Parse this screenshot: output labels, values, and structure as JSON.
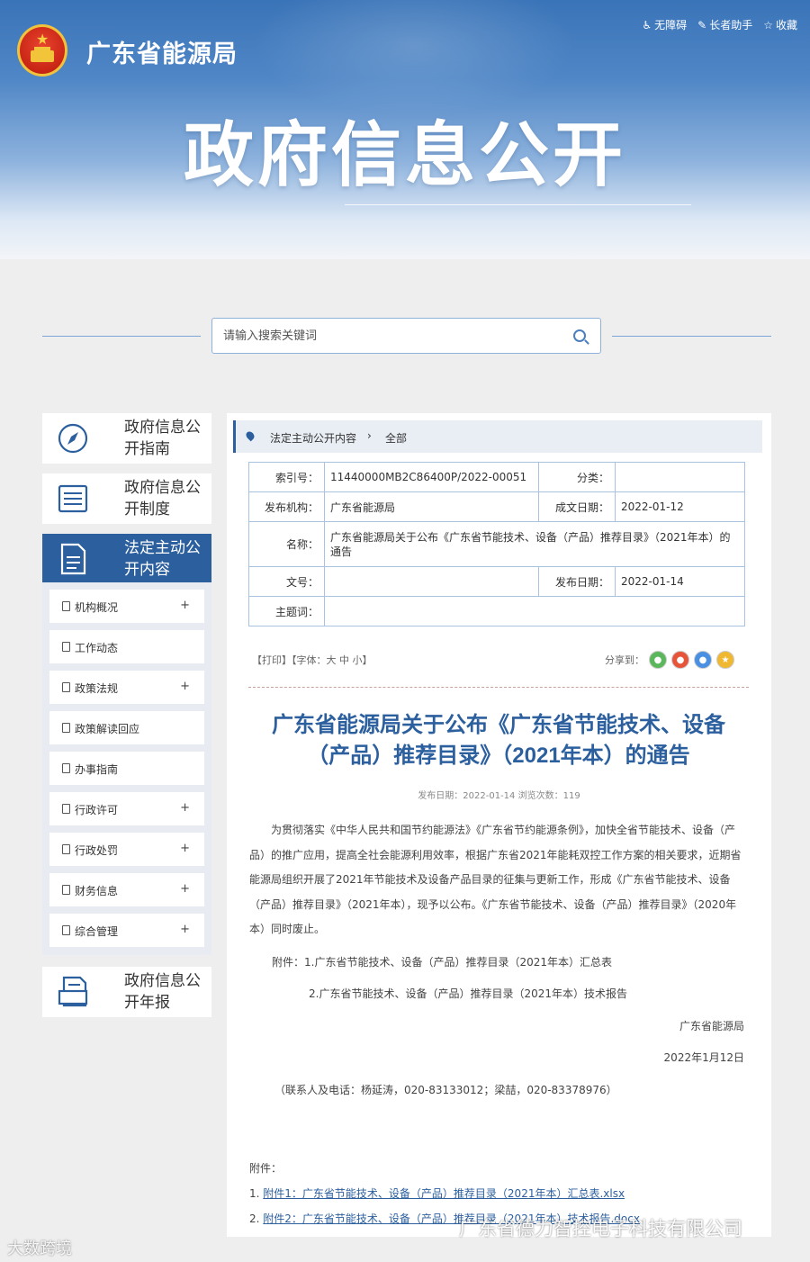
{
  "header": {
    "site_name": "广东省能源局",
    "banner_title": "政府信息公开",
    "top_links": [
      {
        "icon": "accessibility-icon",
        "label": "无障碍"
      },
      {
        "icon": "elder-assist-icon",
        "label": "长者助手"
      },
      {
        "icon": "star-icon",
        "label": "收藏"
      }
    ]
  },
  "search": {
    "placeholder": "请输入搜索关键词"
  },
  "sidebar": {
    "cards": [
      {
        "icon": "compass-icon",
        "label": "政府信息公开指南"
      },
      {
        "icon": "list-doc-icon",
        "label": "政府信息公开制度"
      },
      {
        "icon": "document-icon",
        "label": "法定主动公开内容"
      },
      {
        "icon": "report-icon",
        "label": "政府信息公开年报"
      }
    ],
    "submenu": [
      {
        "label": "机构概况",
        "expand": "+"
      },
      {
        "label": "工作动态",
        "expand": ""
      },
      {
        "label": "政策法规",
        "expand": "+"
      },
      {
        "label": "政策解读回应",
        "expand": ""
      },
      {
        "label": "办事指南",
        "expand": ""
      },
      {
        "label": "行政许可",
        "expand": "+"
      },
      {
        "label": "行政处罚",
        "expand": "+"
      },
      {
        "label": "财务信息",
        "expand": "+"
      },
      {
        "label": "综合管理",
        "expand": "+"
      }
    ]
  },
  "breadcrumb": {
    "item1": "法定主动公开内容",
    "sep": "›",
    "item2": "全部"
  },
  "meta": {
    "index_label": "索引号：",
    "index_value": "11440000MB2C86400P/2022-00051",
    "category_label": "分类：",
    "category_value": "",
    "publisher_label": "发布机构：",
    "publisher_value": "广东省能源局",
    "created_label": "成文日期：",
    "created_value": "2022-01-12",
    "name_label": "名称：",
    "name_value": "广东省能源局关于公布《广东省节能技术、设备（产品）推荐目录》（2021年本）的通告",
    "docno_label": "文号：",
    "docno_value": "",
    "pubdate_label": "发布日期：",
    "pubdate_value": "2022-01-14",
    "keyword_label": "主题词：",
    "keyword_value": ""
  },
  "tools": {
    "text": "【打印】【字体：大 中 小】",
    "share_label": "分享到："
  },
  "share_colors": {
    "wechat": "#5bb75b",
    "weibo": "#e6553a",
    "qq": "#4a90e2",
    "qzone": "#f0b830"
  },
  "article": {
    "title": "广东省能源局关于公布《广东省节能技术、设备（产品）推荐目录》（2021年本）的通告",
    "pubinfo": "发布日期：2022-01-14  浏览次数：119",
    "body": "为贯彻落实《中华人民共和国节约能源法》《广东省节约能源条例》，加快全省节能技术、设备（产品）的推广应用，提高全社会能源利用效率，根据广东省2021年能耗双控工作方案的相关要求，近期省能源局组织开展了2021年节能技术及设备产品目录的征集与更新工作，形成《广东省节能技术、设备（产品）推荐目录》（2021年本），现予以公布。《广东省节能技术、设备（产品）推荐目录》（2020年本）同时废止。",
    "attach1": "附件：1.广东省节能技术、设备（产品）推荐目录（2021年本）汇总表",
    "attach2": "2.广东省节能技术、设备（产品）推荐目录（2021年本）技术报告",
    "signer": "广东省能源局",
    "sign_date": "2022年1月12日",
    "contact": "（联系人及电话：杨延涛，020-83133012；梁喆，020-83378976）",
    "attachments_head": "附件：",
    "files": [
      {
        "num": "1.",
        "text": "附件1：广东省节能技术、设备（产品）推荐目录（2021年本）汇总表.xlsx"
      },
      {
        "num": "2.",
        "text": "附件2：广东省节能技术、设备（产品）推荐目录（2021年本）技术报告.docx"
      }
    ]
  },
  "watermarks": {
    "left": "大数跨境",
    "right": "广东省德力智控电子科技有限公司"
  }
}
